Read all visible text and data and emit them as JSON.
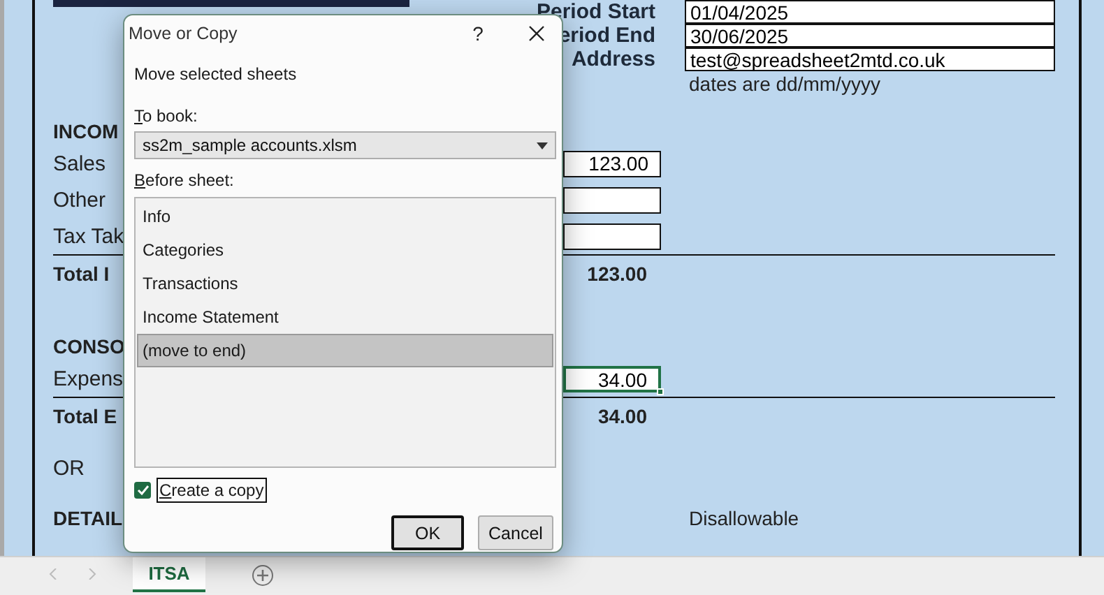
{
  "sheet": {
    "header_fields": [
      {
        "label": "Period Start",
        "value": "01/04/2025"
      },
      {
        "label": "eriod End",
        "value": "30/06/2025"
      },
      {
        "label": "Address",
        "value": "test@spreadsheet2mtd.co.uk"
      }
    ],
    "note": "dates are dd/mm/yyyy",
    "rows": [
      {
        "kind": "heading",
        "label": "INCOM"
      },
      {
        "kind": "input",
        "label": "Sales",
        "value": "123.00",
        "selected": false
      },
      {
        "kind": "input",
        "label": "Other",
        "selected": false
      },
      {
        "kind": "input",
        "label": "Tax Tak",
        "selected": false
      },
      {
        "kind": "total",
        "label": "Total I",
        "value": "123.00"
      },
      {
        "kind": "heading",
        "label": "CONSO"
      },
      {
        "kind": "input",
        "label": "Expens",
        "value": "34.00",
        "selected": true
      },
      {
        "kind": "total",
        "label": "Total E",
        "value": "34.00"
      },
      {
        "kind": "text",
        "label": "OR"
      },
      {
        "kind": "heading",
        "label": "DETAIL",
        "aside": "Disallowable"
      }
    ]
  },
  "dialog": {
    "title": "Move or Copy",
    "help": "?",
    "instruction": "Move selected sheets",
    "to_book_label": "To book:",
    "to_book_value": "ss2m_sample accounts.xlsm",
    "before_label": "Before sheet:",
    "sheets": [
      {
        "label": "Info",
        "selected": false
      },
      {
        "label": "Categories",
        "selected": false
      },
      {
        "label": "Transactions",
        "selected": false
      },
      {
        "label": "Income Statement",
        "selected": false
      },
      {
        "label": "(move to end)",
        "selected": true
      }
    ],
    "copy": {
      "label": "Create a copy",
      "checked": true
    },
    "buttons": [
      {
        "label": "OK",
        "default": true
      },
      {
        "label": "Cancel",
        "default": false
      }
    ]
  },
  "tabs": [
    {
      "label": "ITSA",
      "selected": true
    }
  ]
}
